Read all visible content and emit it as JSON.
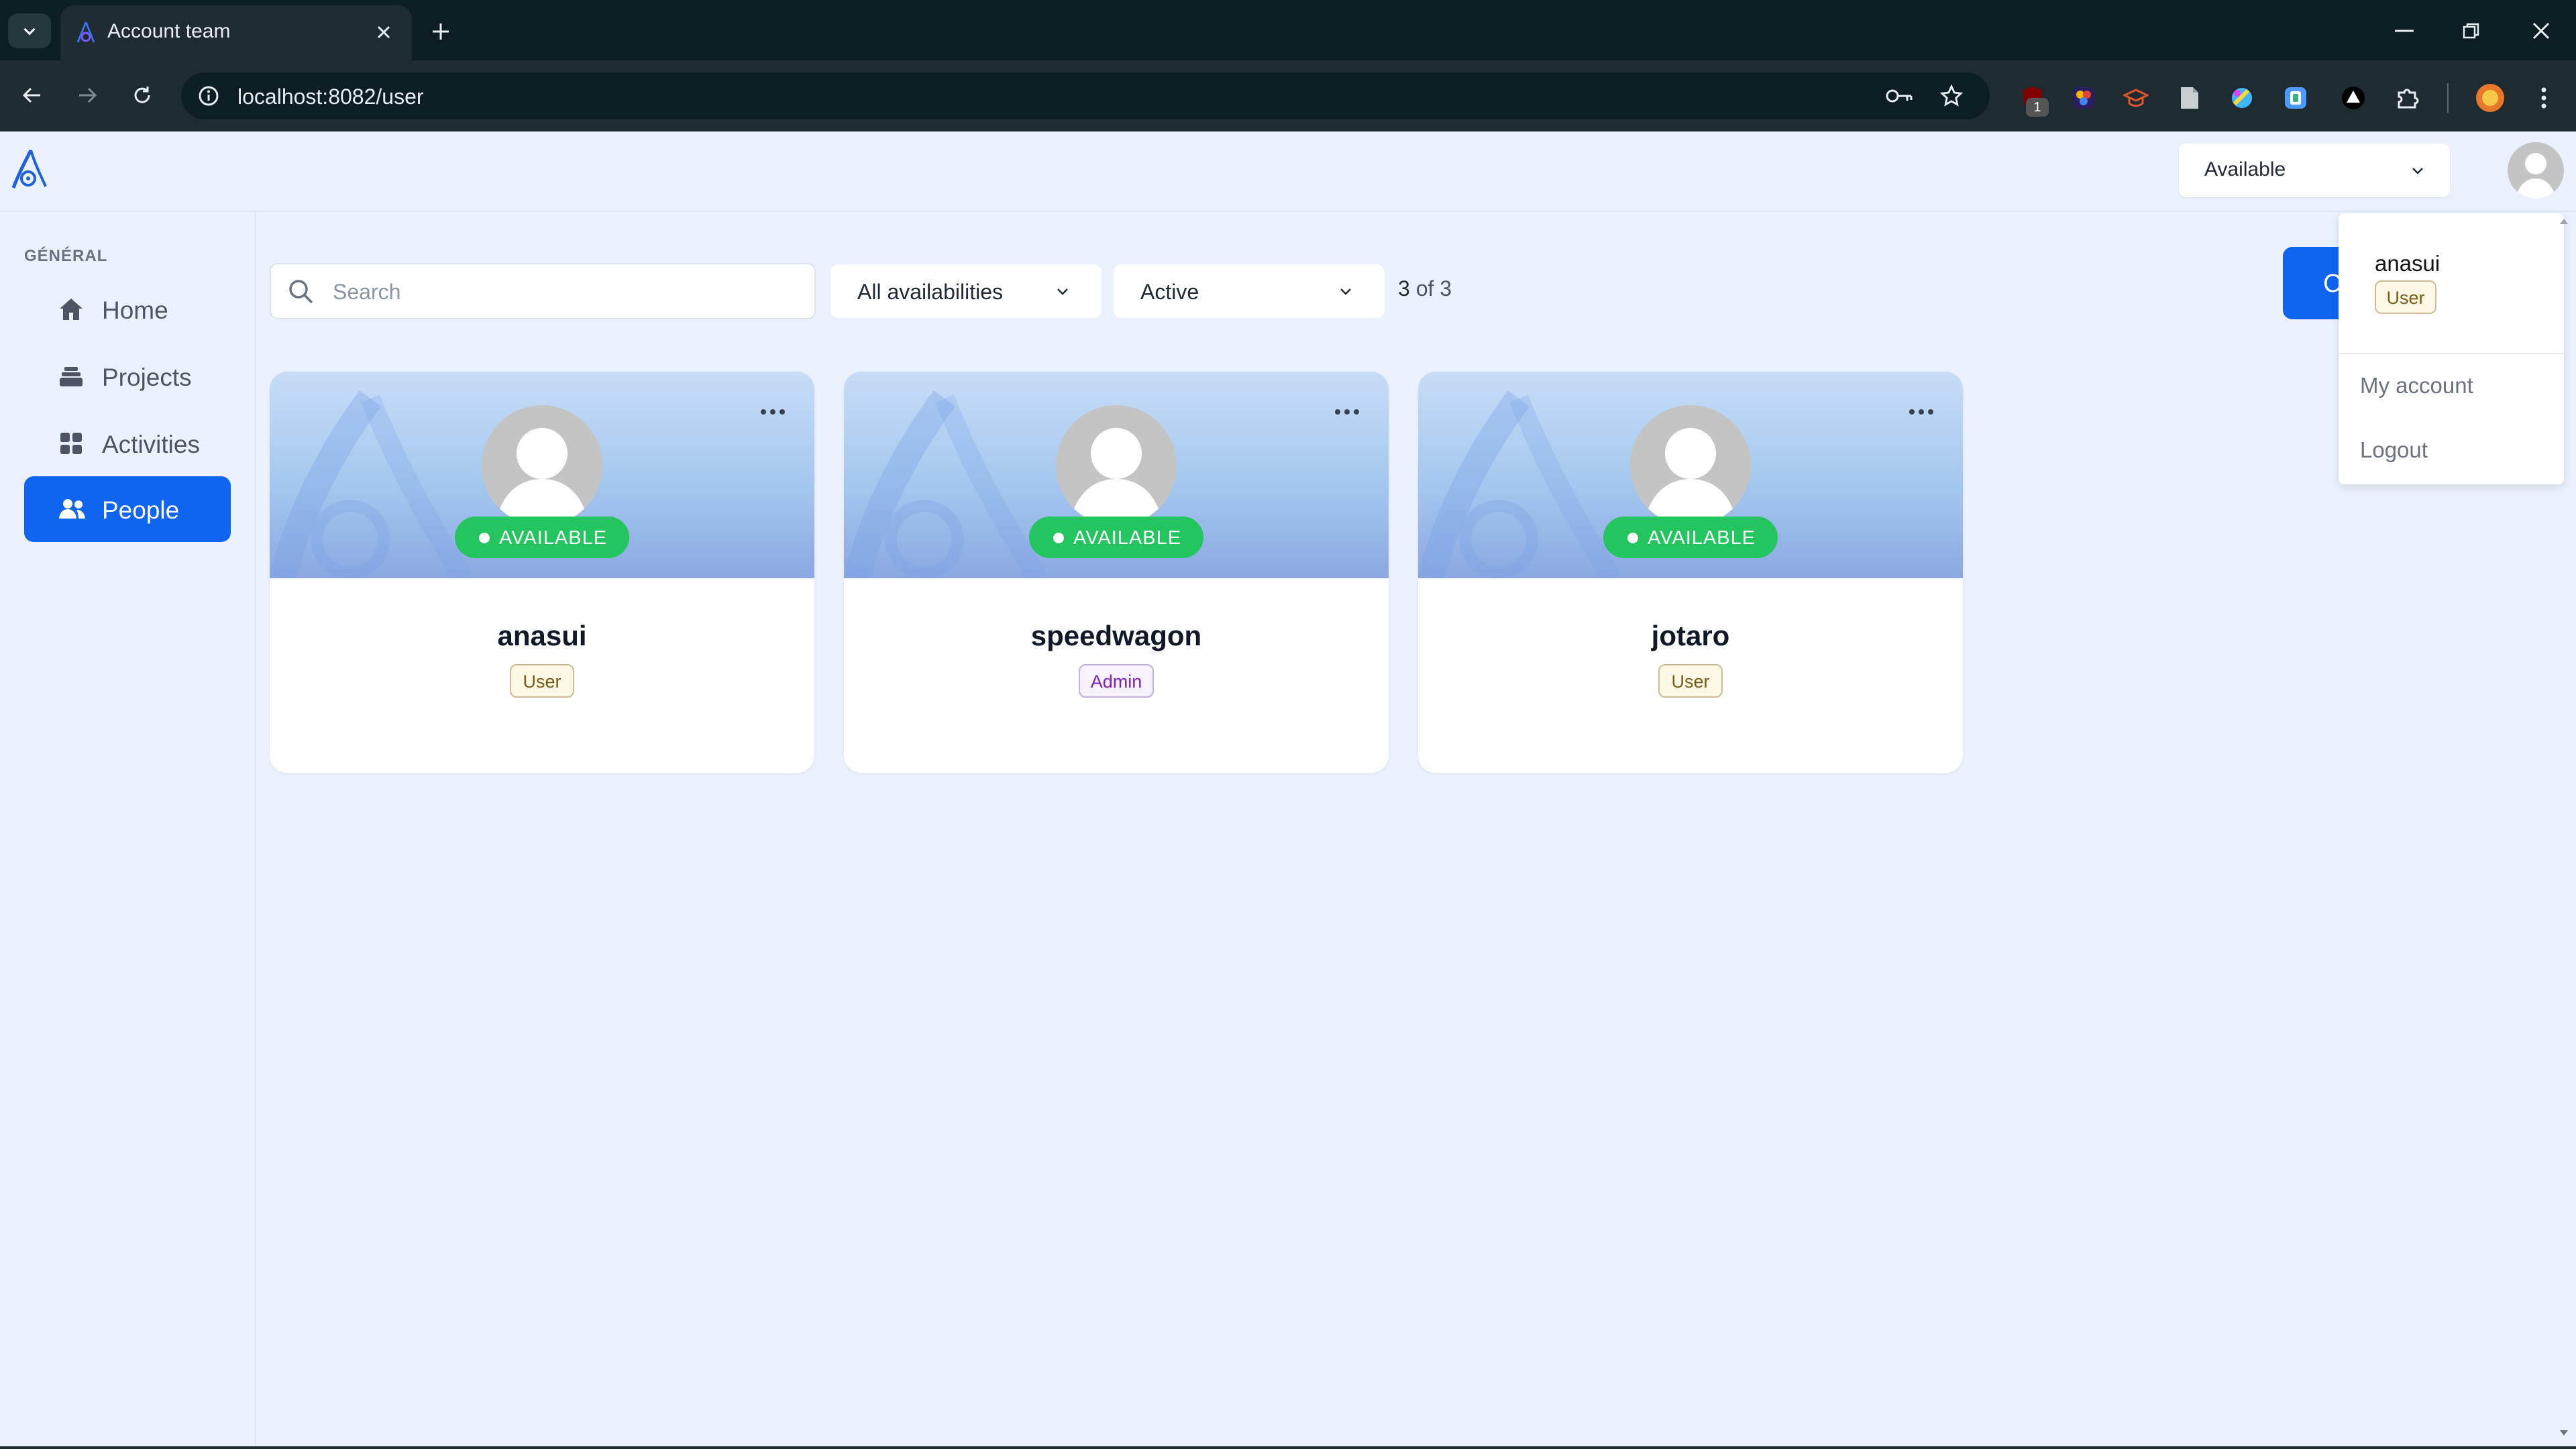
{
  "browser": {
    "tab_title": "Account team",
    "url": "localhost:8082/user",
    "extension_badge": "1"
  },
  "header": {
    "availability_value": "Available"
  },
  "sidebar": {
    "section_label": "GÉNÉRAL",
    "items": [
      {
        "label": "Home",
        "icon": "home-icon"
      },
      {
        "label": "Projects",
        "icon": "layers-icon"
      },
      {
        "label": "Activities",
        "icon": "grid-icon"
      },
      {
        "label": "People",
        "icon": "people-icon",
        "active": true
      }
    ]
  },
  "filters": {
    "search_placeholder": "Search",
    "availability_filter": "All availabilities",
    "status_filter": "Active",
    "count_shown": "3",
    "count_total": "of 3"
  },
  "create_button_label": "C",
  "cards": [
    {
      "name": "anasui",
      "status": "AVAILABLE",
      "role": "User"
    },
    {
      "name": "speedwagon",
      "status": "AVAILABLE",
      "role": "Admin"
    },
    {
      "name": "jotaro",
      "status": "AVAILABLE",
      "role": "User"
    }
  ],
  "user_menu": {
    "name": "anasui",
    "role": "User",
    "items": [
      "My account",
      "Logout"
    ]
  },
  "colors": {
    "accent": "#0f64f0",
    "available": "#22c55e",
    "background": "#ebf2fd"
  }
}
